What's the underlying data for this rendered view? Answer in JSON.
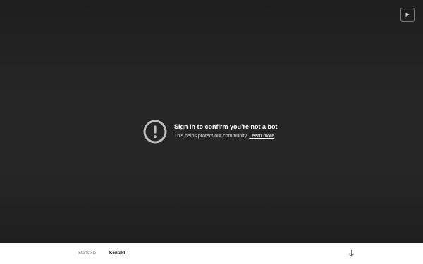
{
  "player": {
    "error_title": "Sign in to confirm you’re not a bot",
    "error_message": "This helps protect our community.",
    "learn_more": "Learn more",
    "icons": {
      "error": "exclamation-circle-icon",
      "play": "play-icon"
    }
  },
  "footer_nav": {
    "items": [
      {
        "label": "Startseite",
        "active": false
      },
      {
        "label": "Kontakt",
        "active": true
      }
    ],
    "scroll_icon": "arrow-down-icon"
  },
  "colors": {
    "player_background": "#262626",
    "text_primary": "#ffffff",
    "footer_background": "#ffffff",
    "nav_inactive": "#7a7a7a",
    "nav_active": "#111111"
  }
}
